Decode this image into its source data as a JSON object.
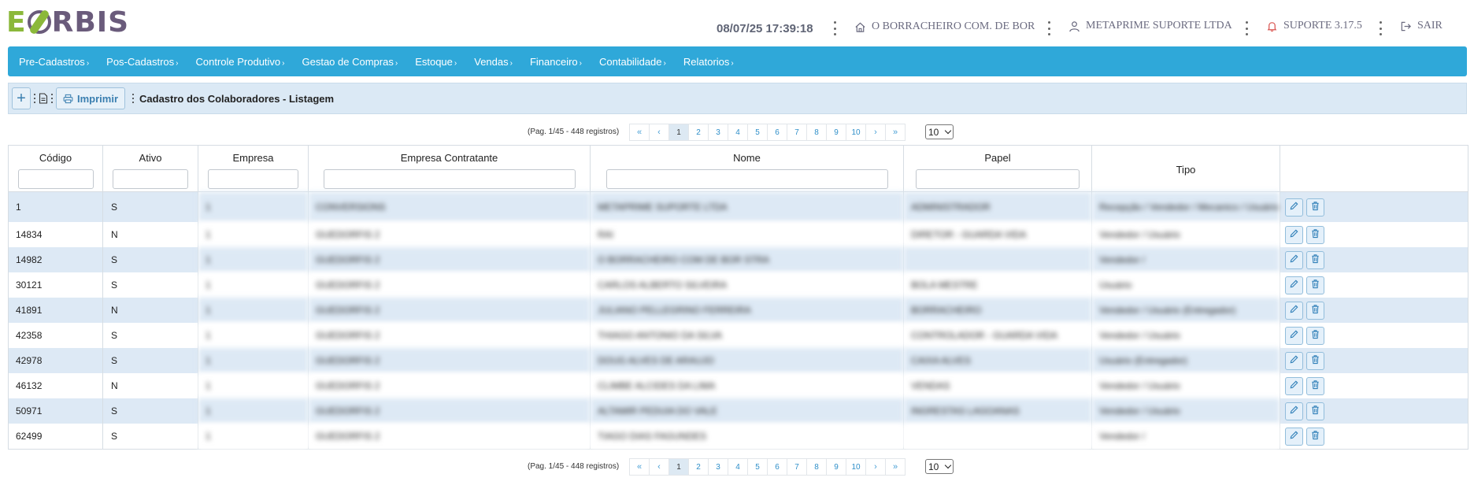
{
  "header": {
    "logo_text": "EORBIS",
    "datetime": "08/07/25 17:39:18",
    "store": "O BORRACHEIRO COM. DE BOR",
    "user": "METAPRIME SUPORTE LTDA",
    "support": "SUPORTE 3.17.5",
    "logout": "SAIR",
    "colors": {
      "logo_green": "#8bb83a",
      "logo_purple": "#6a5b7b",
      "support_icon": "#d9534f"
    }
  },
  "menu": {
    "color": "#2fa8d9",
    "items": [
      {
        "label": "Pre-Cadastros"
      },
      {
        "label": "Pos-Cadastros"
      },
      {
        "label": "Controle Produtivo"
      },
      {
        "label": "Gestao de Compras"
      },
      {
        "label": "Estoque"
      },
      {
        "label": "Vendas"
      },
      {
        "label": "Financeiro"
      },
      {
        "label": "Contabilidade"
      },
      {
        "label": "Relatorios"
      }
    ],
    "arrow": "›"
  },
  "toolbar": {
    "add_symbol": "+",
    "print_label": "Imprimir",
    "title": "Cadastro dos Colaboradores - Listagem"
  },
  "pagination": {
    "info": "(Pag. 1/45 - 448 registros)",
    "first": "«",
    "prev": "‹",
    "next": "›",
    "last": "»",
    "pages": [
      "1",
      "2",
      "3",
      "4",
      "5",
      "6",
      "7",
      "8",
      "9",
      "10"
    ],
    "current_page": "1",
    "rows_per_page": "10"
  },
  "table": {
    "columns": [
      "Código",
      "Ativo",
      "Empresa",
      "Empresa Contratante",
      "Nome",
      "Papel",
      "Tipo"
    ],
    "rows": [
      {
        "codigo": "1",
        "ativo": "S",
        "empresa": "1",
        "contratante": "CONVERSIONS",
        "nome": "METAPRIME SUPORTE LTDA",
        "papel": "ADMINISTRADOR",
        "tipo": "Recepção / Vendedor / Mecanico / Usuário"
      },
      {
        "codigo": "14834",
        "ativo": "N",
        "empresa": "1",
        "contratante": "GUEDORFIS 2",
        "nome": "RAI",
        "papel": "DIRETOR - GUARDA VIDA",
        "tipo": "Vendedor / Usuário"
      },
      {
        "codigo": "14982",
        "ativo": "S",
        "empresa": "1",
        "contratante": "GUEDORFIS 2",
        "nome": "O BORRACHEIRO COM DE BOR STRA",
        "papel": "",
        "tipo": "Vendedor /"
      },
      {
        "codigo": "30121",
        "ativo": "S",
        "empresa": "1",
        "contratante": "GUEDORFIS 2",
        "nome": "CARLOS ALBERTO SILVEIRA",
        "papel": "BOLA MESTRE",
        "tipo": "Usuário"
      },
      {
        "codigo": "41891",
        "ativo": "N",
        "empresa": "1",
        "contratante": "GUEDORFIS 2",
        "nome": "JULIANO PELLEGRINO FERREIRA",
        "papel": "BORRACHEIRO",
        "tipo": "Vendedor / Usuário (Entregador)"
      },
      {
        "codigo": "42358",
        "ativo": "S",
        "empresa": "1",
        "contratante": "GUEDORFIS 2",
        "nome": "THIAGO ANTONIO DA SILVA",
        "papel": "CONTROLADOR - GUARDA VIDA",
        "tipo": "Vendedor / Usuário"
      },
      {
        "codigo": "42978",
        "ativo": "S",
        "empresa": "1",
        "contratante": "GUEDORFIS 2",
        "nome": "DOUG ALVES DE ARAUJO",
        "papel": "CAIXA ALVES",
        "tipo": "Usuário (Entregador)"
      },
      {
        "codigo": "46132",
        "ativo": "N",
        "empresa": "1",
        "contratante": "GUEDORFIS 2",
        "nome": "CLIMBE ALCIDES DA LIMA",
        "papel": "VENDAS",
        "tipo": "Vendedor / Usuário"
      },
      {
        "codigo": "50971",
        "ativo": "S",
        "empresa": "1",
        "contratante": "GUEDORFIS 2",
        "nome": "ALTAMIR PEDUIA DO VALE",
        "papel": "INGRESTAS LAGOANAS",
        "tipo": "Vendedor / Usuário"
      },
      {
        "codigo": "62499",
        "ativo": "S",
        "empresa": "1",
        "contratante": "GUEDORFIS 2",
        "nome": "TIAGO DIAS FAGUNDES",
        "papel": "",
        "tipo": "Vendedor /"
      }
    ],
    "row_colors": {
      "odd": "#dde9f5",
      "even": "#ffffff"
    },
    "action_icons": [
      "pencil-icon",
      "trash-icon"
    ]
  }
}
